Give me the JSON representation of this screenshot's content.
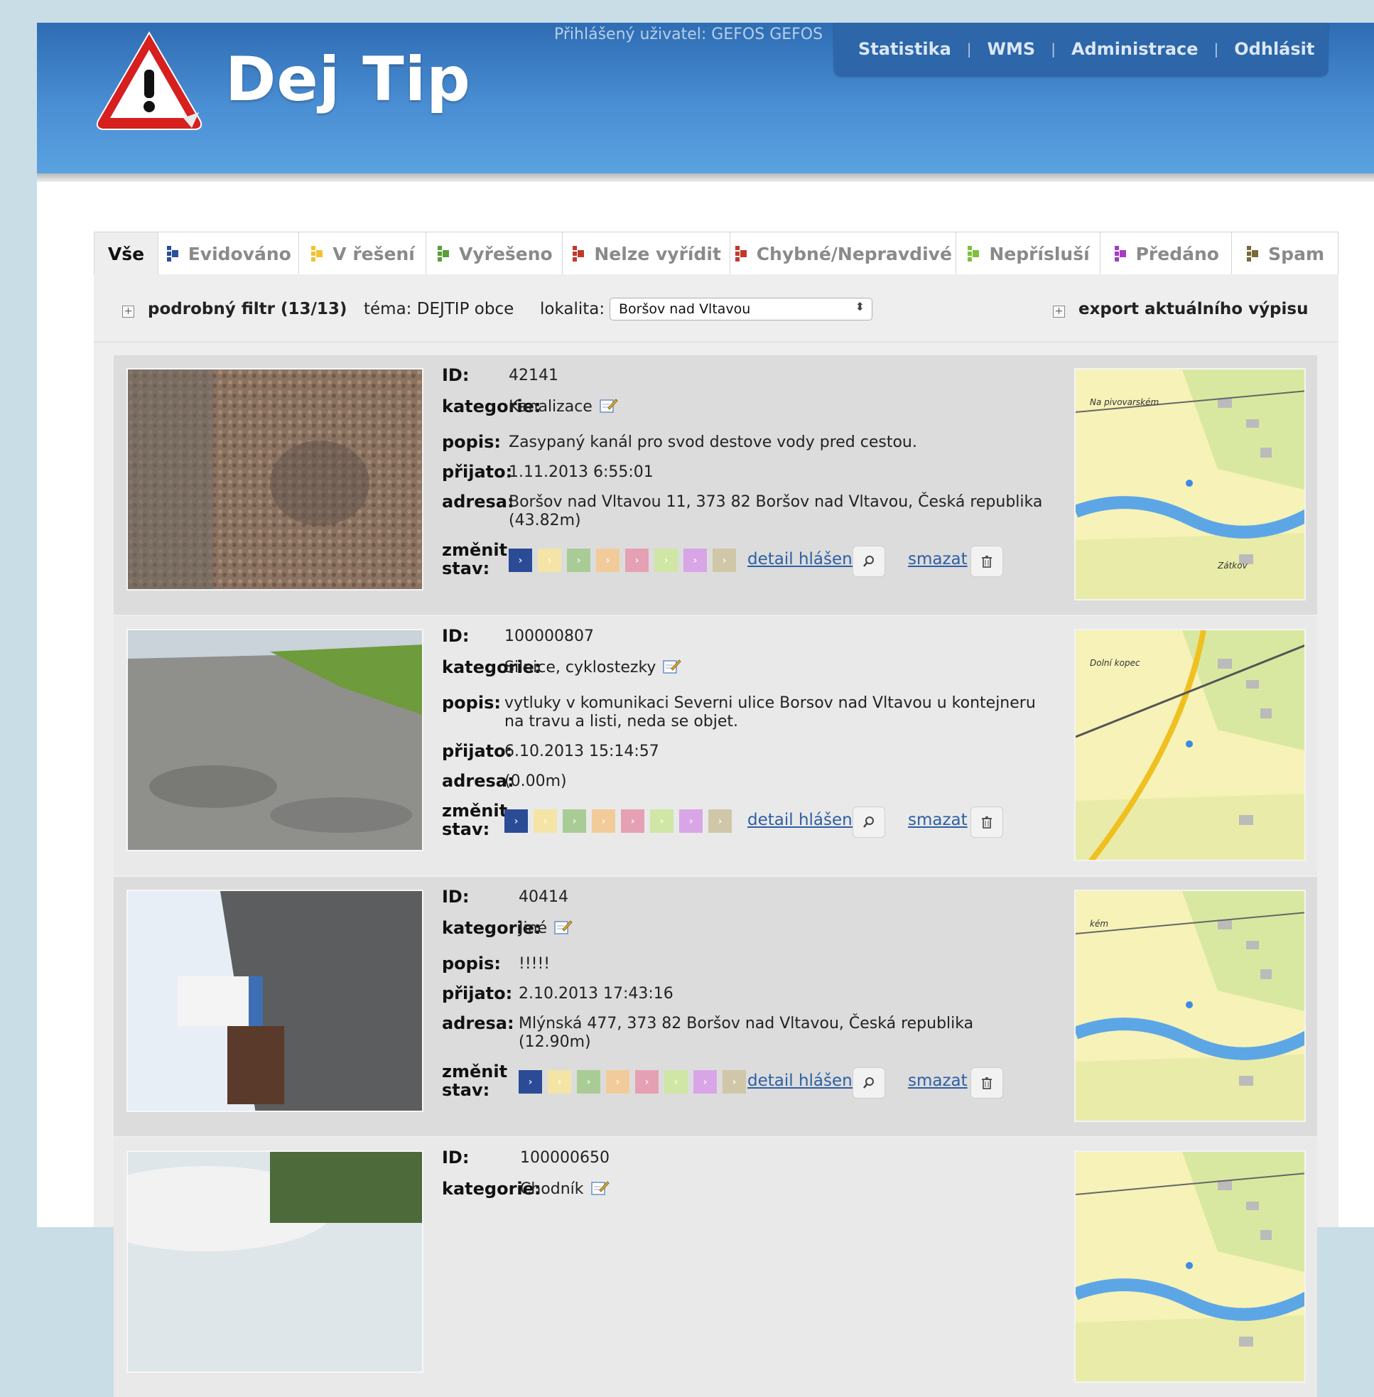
{
  "app": {
    "logo_text": "Dej Tip",
    "logged_user": "Přihlášený uživatel: GEFOS GEFOS"
  },
  "topnav": [
    {
      "label": "Statistika"
    },
    {
      "label": "WMS"
    },
    {
      "label": "Administrace"
    },
    {
      "label": "Odhlásit"
    }
  ],
  "tabs": [
    {
      "label": "Vše",
      "flag": "",
      "active": true
    },
    {
      "label": "Evidováno",
      "flag": "#2a4f9a"
    },
    {
      "label": "V řešení",
      "flag": "#f1c232"
    },
    {
      "label": "Vyřešeno",
      "flag": "#5a9e3a"
    },
    {
      "label": "Nelze vyřídit",
      "flag": "#c0392b"
    },
    {
      "label": "Chybné/Nepravdivé",
      "flag": "#c0392b"
    },
    {
      "label": "Nepřísluší",
      "flag": "#7fbf3f"
    },
    {
      "label": "Předáno",
      "flag": "#a43cc6"
    },
    {
      "label": "Spam",
      "flag": "#7a6a3a"
    }
  ],
  "filter": {
    "detail_label": "podrobný filtr (13/13)",
    "tema": "téma: DEJTIP obce",
    "lokalita_label": "lokalita:",
    "lokalita_value": "Boršov nad Vltavou",
    "export_label": "export aktuálního výpisu"
  },
  "labels": {
    "id": "ID:",
    "kategorie": "kategorie:",
    "popis": "popis:",
    "prijato": "přijato:",
    "adresa": "adresa:",
    "zmenit1": "změnit",
    "zmenit2": "stav:",
    "detail": "detail hlášení",
    "smazat": "smazat"
  },
  "status_colors": [
    "#2b4b96",
    "#f4e4a6",
    "#a9cc96",
    "#f1cc9a",
    "#e5a1b3",
    "#cfe6a5",
    "#d8a6e6",
    "#cfc7a7"
  ],
  "reports": [
    {
      "id": "42141",
      "kategorie": "Kanalizace",
      "popis_lines": [
        "Zasypaný kanál pro svod destove vody pred cestou."
      ],
      "prijato": "1.11.2013 6:55:01",
      "adresa_lines": [
        "Boršov nad Vltavou 11, 373 82 Boršov nad Vltavou, Česká republika",
        "(43.82m)"
      ],
      "map_text": [
        "Na pivovarském",
        "Zátkov"
      ]
    },
    {
      "id": "100000807",
      "kategorie": "Silnice, cyklostezky",
      "popis_lines": [
        "vytluky v komunikaci Severni ulice Borsov nad Vltavou u kontejneru",
        "na travu a listi, neda se objet."
      ],
      "prijato": "6.10.2013 15:14:57",
      "adresa_lines": [
        "(0.00m)"
      ],
      "map_text": [
        "Dolní kopec"
      ]
    },
    {
      "id": "40414",
      "kategorie": "Jiné",
      "popis_lines": [
        "!!!!!"
      ],
      "prijato": "2.10.2013 17:43:16",
      "adresa_lines": [
        "Mlýnská 477, 373 82 Boršov nad Vltavou, Česká republika",
        "(12.90m)"
      ],
      "map_text": [
        "kém"
      ]
    },
    {
      "id": "100000650",
      "kategorie": "Chodník",
      "popis_lines": [],
      "prijato": "",
      "adresa_lines": [],
      "map_text": []
    }
  ]
}
